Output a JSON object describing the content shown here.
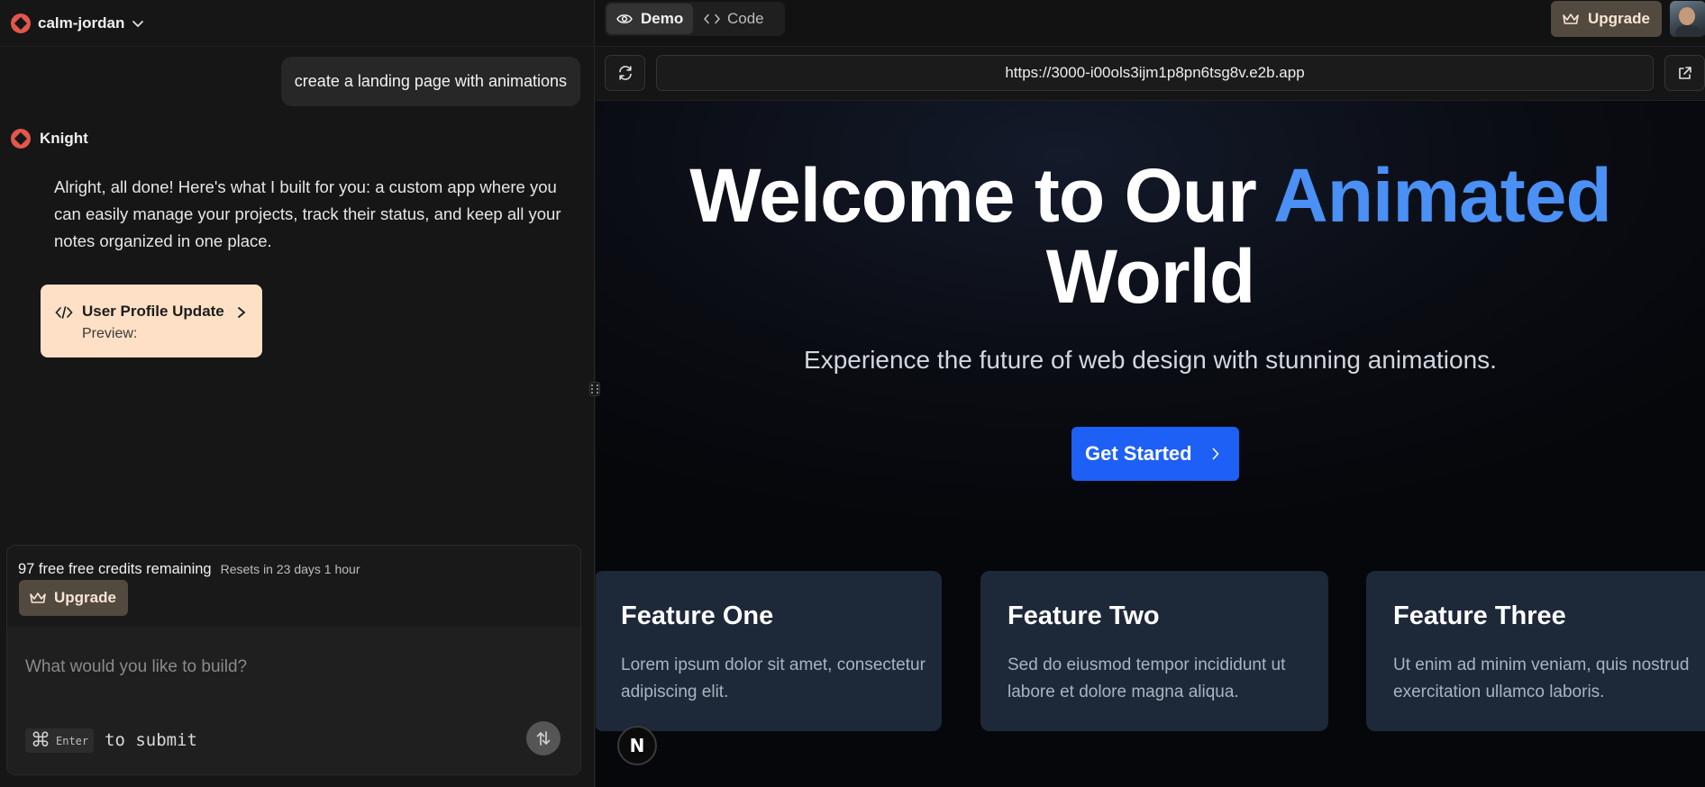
{
  "sidebar": {
    "project_name": "calm-jordan",
    "user_message": "create a landing page with animations",
    "bot_name": "Knight",
    "bot_message": "Alright, all done! Here's what I built for you: a custom app where you can easily manage your projects, track their status, and keep all your notes organized in one place.",
    "artifact": {
      "title": "User Profile Update",
      "subtitle": "Preview:"
    },
    "credits_text": "97 free free credits remaining",
    "resets_text": "Resets in 23 days 1 hour",
    "upgrade_label": "Upgrade",
    "input_placeholder": "What would you like to build?",
    "shortcut_key": "⌘",
    "shortcut_enter": "Enter",
    "submit_hint": "to submit"
  },
  "topbar": {
    "tab_demo": "Demo",
    "tab_code": "Code",
    "active_tab": "Demo",
    "upgrade_label": "Upgrade",
    "url": "https://3000-i00ols3ijm1p8pn6tsg8v.e2b.app"
  },
  "preview": {
    "title_main": "Welcome to Our ",
    "title_accent": "Animated",
    "title_end": "World",
    "subtitle": "Experience the future of web design with stunning animations.",
    "cta_label": "Get Started",
    "features": [
      {
        "title": "Feature One",
        "text": "Lorem ipsum dolor sit amet, consectetur adipiscing elit."
      },
      {
        "title": "Feature Two",
        "text": "Sed do eiusmod tempor incididunt ut labore et dolore magna aliqua."
      },
      {
        "title": "Feature Three",
        "text": "Ut enim ad minim veniam, quis nostrud exercitation ullamco laboris."
      }
    ],
    "framework_badge": "N"
  },
  "colors": {
    "accent_blue": "#4a90f5",
    "cta_blue": "#1e5ff5",
    "upgrade_bg": "#52493f",
    "artifact_bg": "#fde0c5",
    "brand_red": "#e2574c"
  },
  "icons": [
    "brand-logo-icon",
    "chevron-down-icon",
    "code-icon",
    "chevron-right-icon",
    "crown-icon",
    "eye-icon",
    "refresh-icon",
    "external-link-icon",
    "send-icon",
    "nextjs-icon"
  ]
}
